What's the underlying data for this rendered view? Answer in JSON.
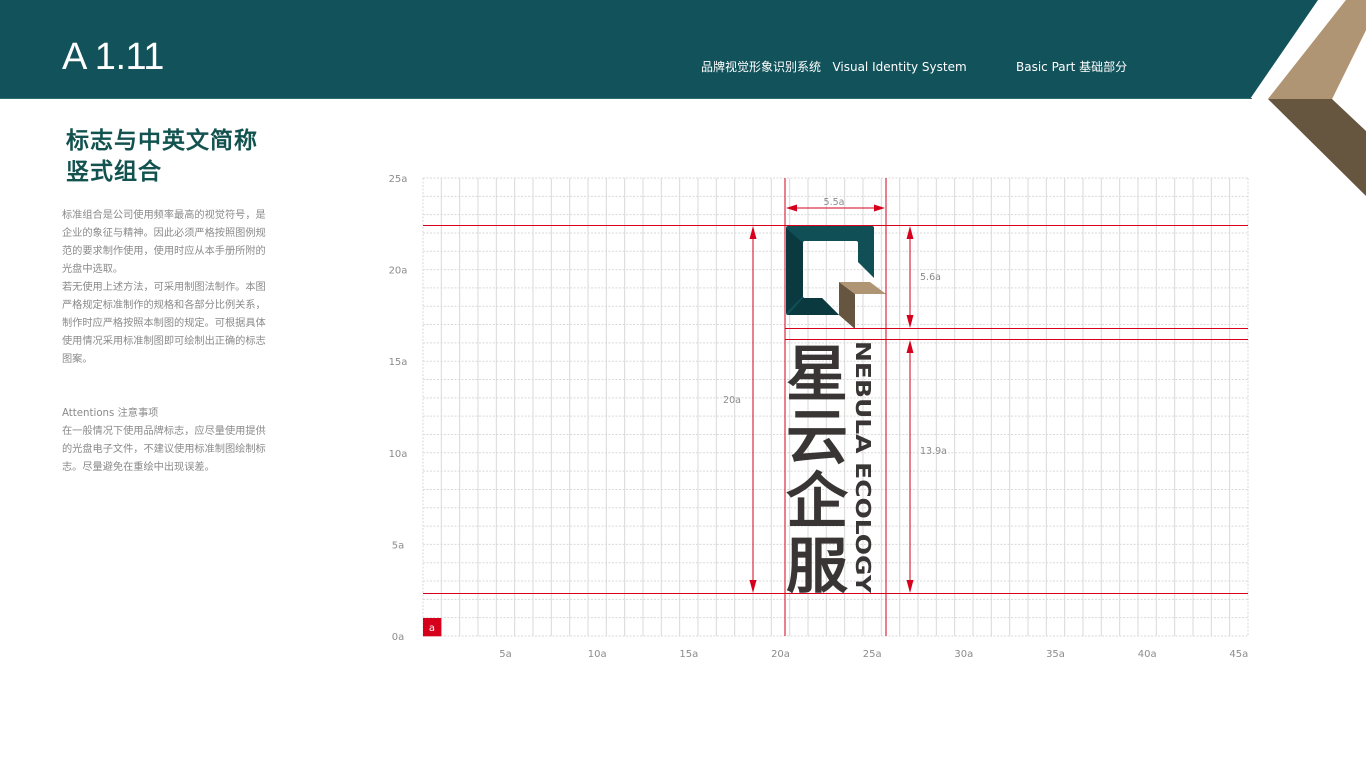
{
  "header": {
    "page_number": "A 1.11",
    "system_title": "品牌视觉形象识别系统   Visual Identity System",
    "part_title": "Basic Part 基础部分",
    "colors": {
      "band": "#12525a",
      "chevron_light": "#b09574",
      "chevron_dark": "#66553f"
    }
  },
  "section": {
    "title_line1": "标志与中英文简称",
    "title_line2": "竖式组合"
  },
  "description": {
    "paragraph1": "标准组合是公司使用频率最高的视觉符号，是企业的象征与精神。因此必须严格按照图例规范的要求制作使用，使用时应从本手册所附的光盘中选取。",
    "paragraph2": "若无使用上述方法，可采用制图法制作。本图严格规定标准制作的规格和各部分比例关系，制作时应严格按照本制图的规定。可根据具体使用情况采用标准制图即可绘制出正确的标志图案。"
  },
  "attentions": {
    "heading": "Attentions 注意事项",
    "text": "在一般情况下使用品牌标志，应尽量使用提供的光盘电子文件，不建议使用标准制图绘制标志。尽量避免在重绘中出现误差。"
  },
  "grid": {
    "unit_label": "a",
    "x_ticks": [
      "5a",
      "10a",
      "15a",
      "20a",
      "25a",
      "30a",
      "35a",
      "40a",
      "45a"
    ],
    "y_ticks": [
      "0a",
      "5a",
      "10a",
      "15a",
      "20a",
      "25a"
    ],
    "columns": 45,
    "rows": 25,
    "accent_color": "#d6001c"
  },
  "logo": {
    "chinese_name": [
      "星",
      "云",
      "企",
      "服"
    ],
    "english_name": "NEBULA ECOLOGY",
    "colors": {
      "mark_teal": "#0f4f55",
      "mark_teal_dark": "#0a3a40",
      "mark_tan": "#b09574",
      "mark_brown": "#66553f",
      "wordmark": "#3a3535"
    }
  },
  "dimensions": {
    "width_label": "5.5a",
    "mark_height_label": "5.6a",
    "total_height_label": "20a",
    "text_height_label": "13.9a"
  }
}
